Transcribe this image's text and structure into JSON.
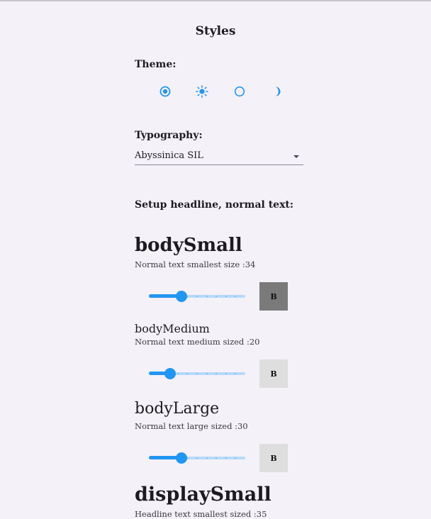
{
  "page": {
    "title": "Styles"
  },
  "theme": {
    "label": "Theme:",
    "options": [
      "auto-theme-icon",
      "light-theme-icon",
      "system-theme-icon",
      "dark-theme-icon"
    ],
    "selected": 0,
    "accent": "#2196f3"
  },
  "typography": {
    "label": "Typography:",
    "value": "Abyssinica SIL"
  },
  "setup": {
    "label": "Setup headline, normal text:"
  },
  "styles": [
    {
      "title": "bodySmall",
      "subtitle": "Normal text smallest size :34",
      "slider_fraction": 0.34,
      "bold_label": "B",
      "bold_on": true
    },
    {
      "title": "bodyMedium",
      "subtitle": "Normal text medium sized :20",
      "slider_fraction": 0.22,
      "bold_label": "B",
      "bold_on": false
    },
    {
      "title": "bodyLarge",
      "subtitle": "Normal text large sized :30",
      "slider_fraction": 0.34,
      "bold_label": "B",
      "bold_on": false
    },
    {
      "title": "displaySmall",
      "subtitle": "Headline text smallest sized :35"
    }
  ]
}
